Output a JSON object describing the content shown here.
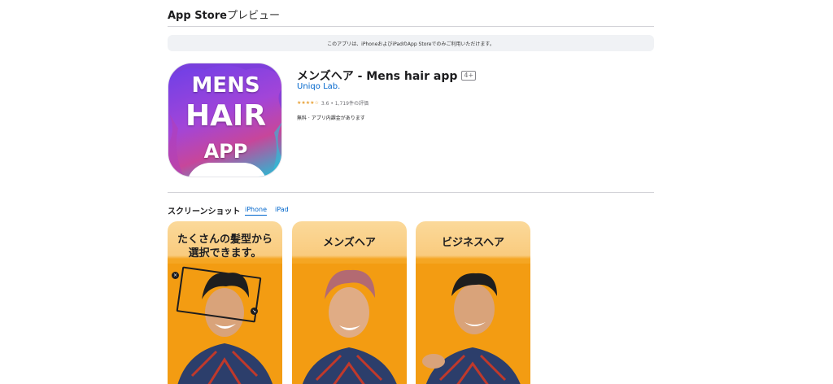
{
  "header": {
    "title": "App Store",
    "subtitle": "プレビュー"
  },
  "banner": {
    "text": "このアプリは、iPhoneおよびiPadのApp Storeでのみご利用いただけます。"
  },
  "app": {
    "icon_lines": [
      "MENS",
      "HAIR",
      "APP"
    ],
    "title": "メンズヘア - Mens hair app",
    "age_rating": "4+",
    "developer": "Uniqo Lab.",
    "stars": "★★★★☆",
    "rating_text": "3.6 • 1,719件の評価",
    "price": "無料 · アプリ内課金があります"
  },
  "screenshots": {
    "heading": "スクリーンショット",
    "tabs": [
      {
        "label": "iPhone"
      },
      {
        "label": "iPad"
      }
    ],
    "items": [
      {
        "caption_line1": "たくさんの髪型から",
        "caption_line2": "選択できます。"
      },
      {
        "caption_line1": "メンズヘア"
      },
      {
        "caption_line1": "ビジネスヘア"
      }
    ]
  },
  "colors": {
    "link": "#0066cc",
    "star": "#e8a33a",
    "screenshot_bg": "#f5a623"
  }
}
